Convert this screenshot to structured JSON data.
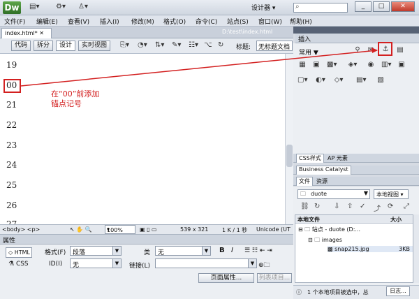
{
  "app": {
    "logo": "Dw",
    "workspace": "设计器",
    "window_buttons": [
      "_",
      "□",
      "✕"
    ]
  },
  "menu": [
    "文件(F)",
    "编辑(E)",
    "查看(V)",
    "插入(I)",
    "修改(M)",
    "格式(O)",
    "命令(C)",
    "站点(S)",
    "窗口(W)",
    "帮助(H)"
  ],
  "document": {
    "tab_label": "index.html*",
    "path": "D:\\test\\index.html",
    "view_buttons": [
      "代码",
      "拆分",
      "设计",
      "实时视图"
    ],
    "title_label": "标题:",
    "title_value": "无标题文档"
  },
  "editor": {
    "line_numbers": [
      "19",
      "00",
      "21",
      "22",
      "23",
      "24",
      "25",
      "26",
      "27"
    ],
    "annotation": "在“00”前添加锚点记号",
    "annotation_color": "#d32020"
  },
  "status": {
    "tags": "<body> <p>",
    "zoom": "100%",
    "dimensions": "539 x 321",
    "size": "1 K / 1 秒",
    "encoding": "Unicode (UT"
  },
  "properties": {
    "header": "属性",
    "html_btn": "HTML",
    "css_btn": "CSS",
    "format_label": "格式(F)",
    "format_value": "段落",
    "class_label": "类",
    "class_value": "无",
    "id_label": "ID(I)",
    "id_value": "无",
    "link_label": "链接(L)",
    "link_value": "",
    "bold": "B",
    "italic": "I",
    "page_props_button": "页面属性...",
    "list_item_button": "列表项目..."
  },
  "insert_panel": {
    "tab": "插入",
    "category": "常用"
  },
  "css_panel": {
    "tabs": [
      "CSS样式",
      "AP 元素"
    ]
  },
  "bc_panel": {
    "tab": "Business Catalyst"
  },
  "files_panel": {
    "tabs": [
      "文件",
      "资源"
    ],
    "site": "duote",
    "view": "本地视图",
    "columns": [
      "本地文件",
      "大小"
    ],
    "rows": [
      {
        "name": "站点 - duote (D:...",
        "size": ""
      },
      {
        "name": "images",
        "size": ""
      },
      {
        "name": "snap215.jpg",
        "size": "3KB"
      }
    ],
    "status": "1 个本地项目被选中，总",
    "log_button": "日志..."
  }
}
